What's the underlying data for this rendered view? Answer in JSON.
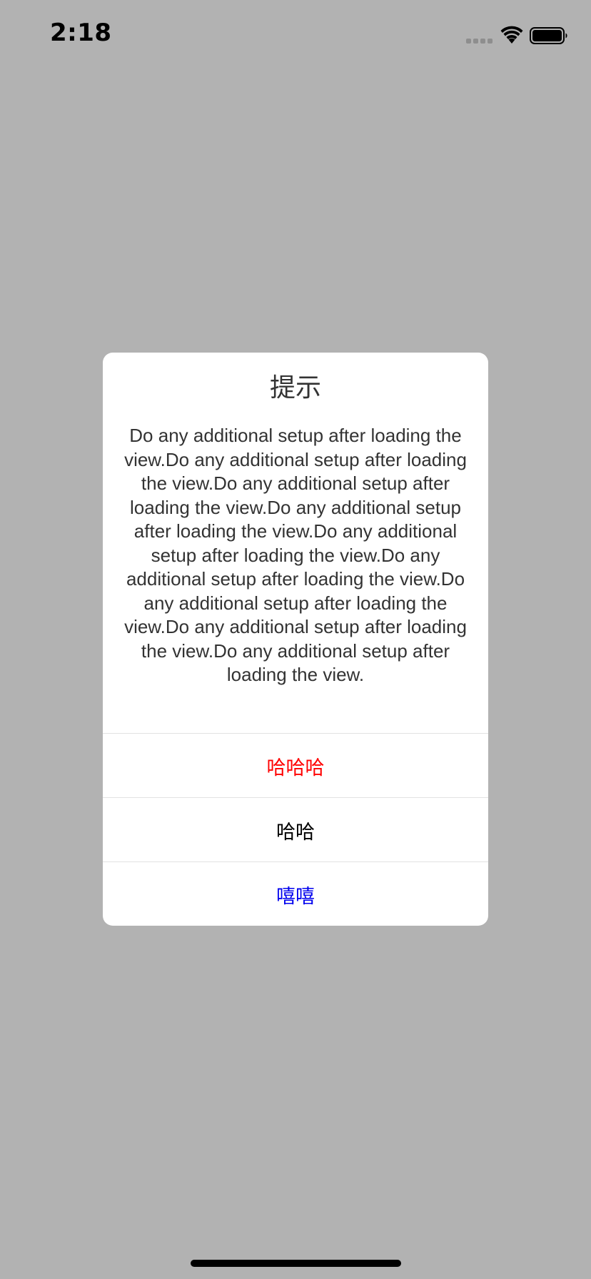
{
  "status_bar": {
    "time": "2:18",
    "signal_icon": "cellular-signal-icon",
    "wifi_icon": "wifi-icon",
    "battery_icon": "battery-icon"
  },
  "alert": {
    "title": "提示",
    "message": "Do any additional setup after loading the view.Do any additional setup after loading the view.Do any additional setup after loading the view.Do any additional setup after loading the view.Do any additional setup after loading the view.Do any additional setup after loading the view.Do any additional setup after loading the view.Do any additional setup after loading the view.Do any additional setup after loading the view.",
    "actions": [
      {
        "label": "哈哈哈",
        "color": "#ff0000"
      },
      {
        "label": "哈哈",
        "color": "#000000"
      },
      {
        "label": "嘻嘻",
        "color": "#0000ee"
      }
    ]
  },
  "colors": {
    "dim_background": "#b2b2b2",
    "dialog_background": "#ffffff",
    "text": "#333333",
    "separator": "#e2e2e2"
  }
}
